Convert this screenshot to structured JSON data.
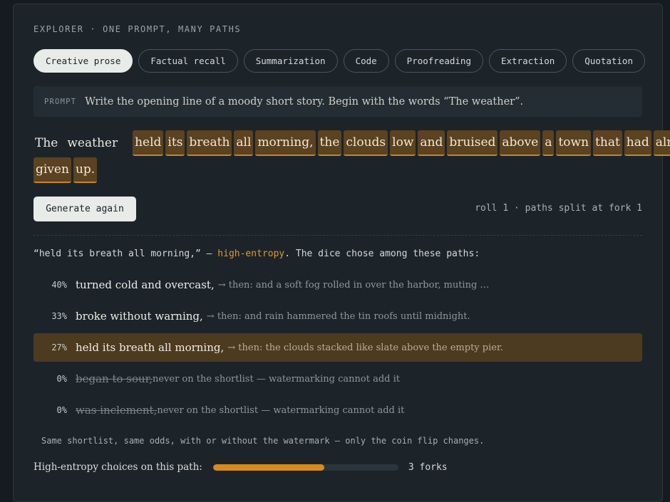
{
  "header": {
    "eyebrow": "EXPLORER · ONE PROMPT, MANY PATHS"
  },
  "tabs": [
    {
      "label": "Creative prose",
      "active": true
    },
    {
      "label": "Factual recall",
      "active": false
    },
    {
      "label": "Summarization",
      "active": false
    },
    {
      "label": "Code",
      "active": false
    },
    {
      "label": "Proofreading",
      "active": false
    },
    {
      "label": "Extraction",
      "active": false
    },
    {
      "label": "Quotation",
      "active": false
    }
  ],
  "prompt": {
    "label": "PROMPT",
    "text": "Write the opening line of a moody short story. Begin with the words “The weather”."
  },
  "story": {
    "fixed": [
      "The",
      "weather"
    ],
    "tokens": [
      "held",
      "its",
      "breath",
      "all",
      "morning,",
      "the",
      "clouds",
      "low",
      "and",
      "bruised",
      "above",
      "a",
      "town",
      "that",
      "had",
      "already",
      "given",
      "up."
    ]
  },
  "controls": {
    "generate_label": "Generate again",
    "roll_status": "roll 1 · paths split at fork 1"
  },
  "fork": {
    "quote": "“held its breath all morning,”",
    "dash": " — ",
    "tag": "high-entropy",
    "suffix": ". The dice chose among these paths:"
  },
  "paths": [
    {
      "pct": "40%",
      "text": "turned cold and overcast,",
      "then": "→ then: and a soft fog rolled in over the harbor, muting …",
      "state": "normal"
    },
    {
      "pct": "33%",
      "text": "broke without warning,",
      "then": "→ then: and rain hammered the tin roofs until midnight.",
      "state": "normal"
    },
    {
      "pct": "27%",
      "text": "held its breath all morning,",
      "then": "→ then: the clouds stacked like slate above the empty pier.",
      "state": "chosen"
    },
    {
      "pct": "0%",
      "text": "began to sour,",
      "then": " never on the shortlist — watermarking cannot add it",
      "state": "dead"
    },
    {
      "pct": "0%",
      "text": "was inclement,",
      "then": " never on the shortlist — watermarking cannot add it",
      "state": "dead"
    }
  ],
  "note": "Same shortlist, same odds, with or without the watermark — only the coin flip changes.",
  "meter": {
    "label": "High-entropy choices on this path:",
    "fill_fraction": 0.6,
    "count": "3 forks"
  },
  "colors": {
    "accent": "#d88a1d",
    "token_bg": "#5b4220",
    "chosen_bg": "#4d3b20",
    "panel": "#1c242a"
  }
}
